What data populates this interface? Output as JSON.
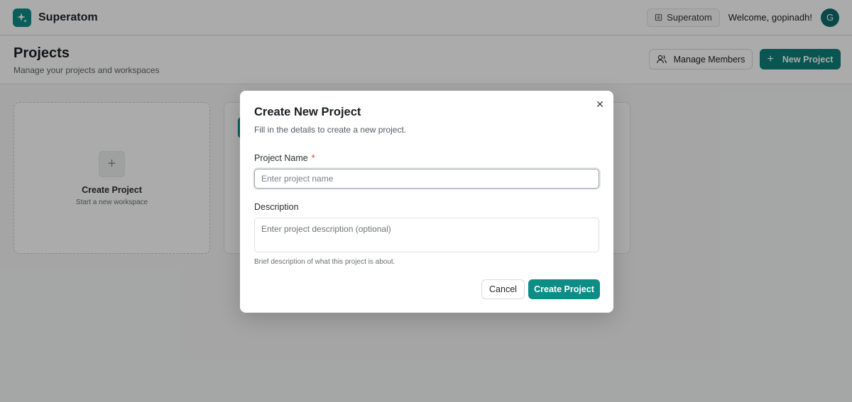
{
  "colors": {
    "accent": "#0e8c86",
    "required": "#dd3333",
    "overlay": "rgba(0,0,0,0.33)"
  },
  "topbar": {
    "logo_icon": "sparkle-icon",
    "brand": "Superatom",
    "org_icon": "building-icon",
    "org_name": "Superatom",
    "welcome": "Welcome, gopinadh!",
    "avatar_initial": "G"
  },
  "page": {
    "title": "Projects",
    "subtitle": "Manage your projects and workspaces",
    "manage_members_icon": "users-icon",
    "manage_members_label": "Manage Members",
    "new_project_icon": "plus-icon",
    "new_project_label": "New Project"
  },
  "create_card": {
    "icon": "plus-icon",
    "plus": "+",
    "title": "Create Project",
    "subtitle": "Start a new workspace"
  },
  "modal": {
    "title": "Create New Project",
    "subtitle": "Fill in the details to create a new project.",
    "close_icon": "close-icon",
    "close_glyph": "✕",
    "name_label": "Project Name",
    "required_mark": "*",
    "name_placeholder": "Enter project name",
    "name_value": "",
    "description_label": "Description",
    "description_placeholder": "Enter project description (optional)",
    "description_value": "",
    "hint": "Brief description of what this project is about.",
    "cancel_label": "Cancel",
    "create_label": "Create Project"
  }
}
